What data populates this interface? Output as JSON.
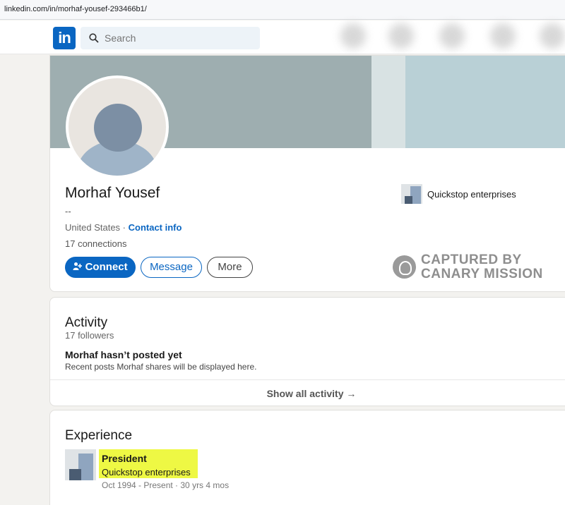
{
  "browser": {
    "url": "linkedin.com/in/morhaf-yousef-293466b1/"
  },
  "nav": {
    "logo": "in",
    "search_placeholder": "Search"
  },
  "profile": {
    "name": "Morhaf Yousef",
    "headline": "--",
    "location": "United States",
    "location_sep": " · ",
    "contact_info": "Contact info",
    "connections": "17 connections",
    "buttons": {
      "connect": "Connect",
      "message": "Message",
      "more": "More"
    },
    "company": "Quickstop enterprises"
  },
  "watermark": {
    "line1": "CAPTURED BY",
    "line2": "CANARY MISSION"
  },
  "activity": {
    "title": "Activity",
    "followers": "17 followers",
    "empty_title": "Morhaf hasn’t posted yet",
    "empty_sub": "Recent posts Morhaf shares will be displayed here.",
    "show_all": "Show all activity →"
  },
  "experience": {
    "title": "Experience",
    "items": [
      {
        "role": "President",
        "company": "Quickstop enterprises",
        "dates": "Oct 1994 - Present · 30 yrs 4 mos"
      }
    ]
  },
  "colors": {
    "brand": "#0a66c2",
    "highlight": "#eef844"
  }
}
